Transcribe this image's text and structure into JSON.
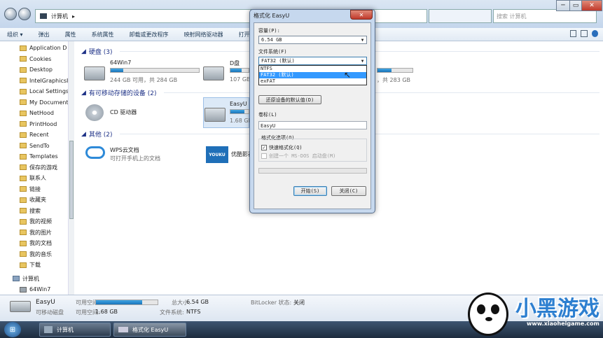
{
  "window": {
    "breadcrumb": "计算机",
    "search_placeholder": "搜索 计算机",
    "controls": {
      "minimize": "─",
      "maximize": "▭",
      "close": "✕"
    }
  },
  "toolbar": {
    "items": [
      "组织 ▾",
      "弹出",
      "属性",
      "系统属性",
      "卸载或更改程序",
      "映射网络驱动器",
      "打开"
    ]
  },
  "sidebar": {
    "items": [
      "Application D",
      "Cookies",
      "Desktop",
      "IntelGraphicsI",
      "Local Settings",
      "My Document",
      "NetHood",
      "PrintHood",
      "Recent",
      "SendTo",
      "Templates",
      "保存的游戏",
      "联系人",
      "链接",
      "收藏夹",
      "搜索",
      "我的视频",
      "我的图片",
      "我的文档",
      "我的音乐",
      "下载"
    ],
    "computer": "计算机",
    "drive_64win7": "64Win7"
  },
  "main": {
    "group_hdd": "硬盘 (3)",
    "group_removable": "有可移动存储的设备 (2)",
    "group_other": "其他 (2)",
    "drives": [
      {
        "name": "64Win7",
        "free": "244 GB 可用，共 284 GB",
        "used_pct": 14
      },
      {
        "name": "D盘",
        "free": "107 GB",
        "used_pct": 60
      },
      {
        "name": "",
        "free": "，共 283 GB",
        "used_pct": 40
      }
    ],
    "cd": "CD 驱动器",
    "easyu": {
      "name": "EasyU",
      "free": "1.68 GB",
      "used_pct": 75
    },
    "wps": {
      "name": "WPS云文档",
      "sub": "可打开手机上的文档"
    },
    "youku": {
      "name": "优酷影视",
      "logo": "YOUKU"
    }
  },
  "details": {
    "name": "EasyU",
    "kind": "可移动磁盘",
    "free_label": "可用空间:",
    "total_label": "总大小:",
    "total": "6.54 GB",
    "free_label2": "可用空间:",
    "free": "1.68 GB",
    "fs_label": "文件系统:",
    "fs": "NTFS",
    "bitlocker_label": "BitLocker 状态:",
    "bitlocker": "关闭",
    "used_pct": 75
  },
  "taskbar": {
    "start": "⊞",
    "tasks": [
      "计算机",
      "格式化 EasyU"
    ]
  },
  "dialog": {
    "title": "格式化 EasyU",
    "close": "✕",
    "capacity_label": "容量(P):",
    "capacity": "6.54 GB",
    "fs_label": "文件系统(F)",
    "fs_selected": "FAT32 (默认)",
    "fs_options": [
      "NTFS",
      "FAT32 (默认)",
      "exFAT"
    ],
    "fs_hover_index": 1,
    "restore_button": "还原设备的默认值(D)",
    "volume_label": "卷标(L)",
    "volume_value": "EasyU",
    "options_label": "格式化选项(O)",
    "quick_format": "快速格式化(Q)",
    "quick_format_checked": true,
    "msdos": "创建一个 MS-DOS 启动盘(M)",
    "msdos_checked": false,
    "progress": 0,
    "start_button": "开始(S)",
    "close_button": "关闭(C)"
  },
  "watermark": {
    "text": "小黑游戏",
    "url": "www.xiaoheigame.com"
  }
}
